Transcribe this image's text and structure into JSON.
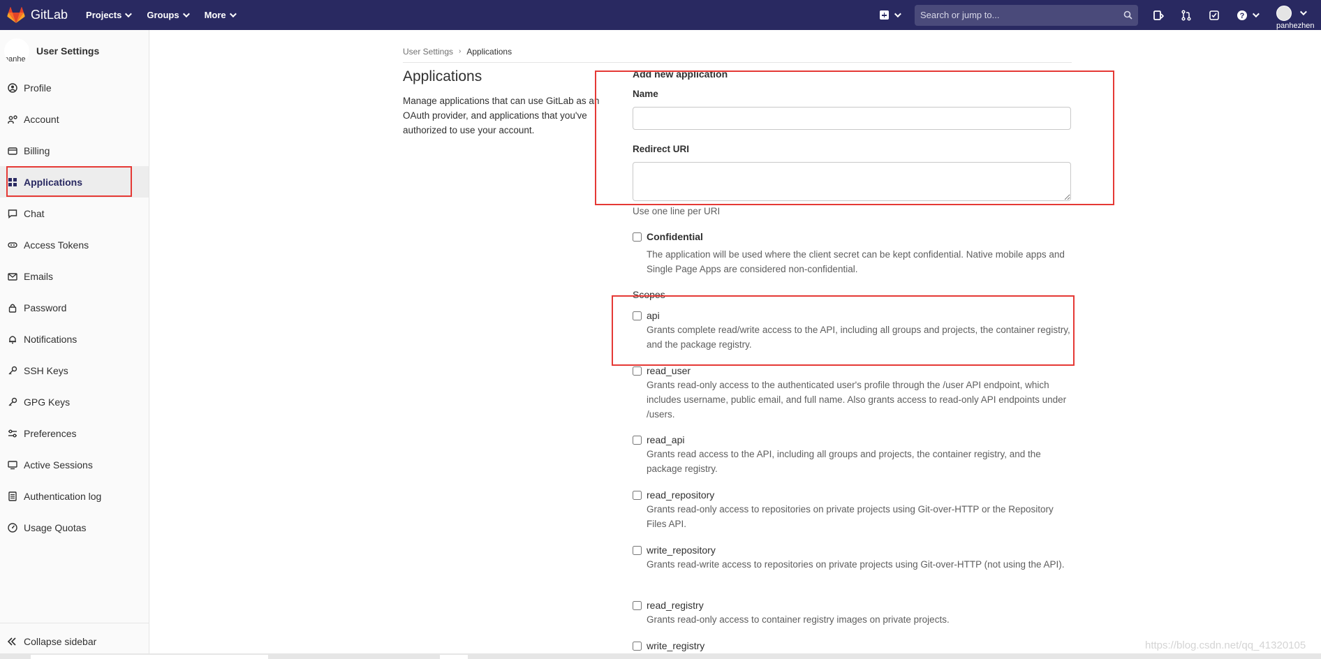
{
  "navbar": {
    "brand": "GitLab",
    "menu": [
      {
        "label": "Projects"
      },
      {
        "label": "Groups"
      },
      {
        "label": "More"
      }
    ],
    "search_placeholder": "Search or jump to...",
    "username": "panhezhen",
    "colors": {
      "bar": "#292961",
      "logo": "#e24329"
    }
  },
  "sidebar": {
    "title": "User Settings",
    "avatar_text": "panhe",
    "items": [
      {
        "label": "Profile",
        "icon": "profile-icon"
      },
      {
        "label": "Account",
        "icon": "account-icon"
      },
      {
        "label": "Billing",
        "icon": "billing-icon"
      },
      {
        "label": "Applications",
        "icon": "applications-icon",
        "active": true
      },
      {
        "label": "Chat",
        "icon": "chat-icon"
      },
      {
        "label": "Access Tokens",
        "icon": "token-icon"
      },
      {
        "label": "Emails",
        "icon": "email-icon"
      },
      {
        "label": "Password",
        "icon": "lock-icon"
      },
      {
        "label": "Notifications",
        "icon": "bell-icon"
      },
      {
        "label": "SSH Keys",
        "icon": "key-icon"
      },
      {
        "label": "GPG Keys",
        "icon": "key-icon"
      },
      {
        "label": "Preferences",
        "icon": "preferences-icon"
      },
      {
        "label": "Active Sessions",
        "icon": "monitor-icon"
      },
      {
        "label": "Authentication log",
        "icon": "log-icon"
      },
      {
        "label": "Usage Quotas",
        "icon": "quota-icon"
      }
    ],
    "collapse_label": "Collapse sidebar"
  },
  "breadcrumb": {
    "parent": "User Settings",
    "current": "Applications"
  },
  "main": {
    "title": "Applications",
    "description": "Manage applications that can use GitLab as an OAuth provider, and applications that you've authorized to use your account."
  },
  "form": {
    "section_title": "Add new application",
    "name_label": "Name",
    "name_value": "",
    "redirect_label": "Redirect URI",
    "redirect_value": "",
    "redirect_help": "Use one line per URI",
    "confidential_label": "Confidential",
    "confidential_checked": false,
    "confidential_desc": "The application will be used where the client secret can be kept confidential. Native mobile apps and Single Page Apps are considered non-confidential.",
    "scopes_title": "Scopes",
    "scopes": [
      {
        "name": "api",
        "checked": false,
        "desc": "Grants complete read/write access to the API, including all groups and projects, the container registry, and the package registry."
      },
      {
        "name": "read_user",
        "checked": false,
        "desc": "Grants read-only access to the authenticated user's profile through the /user API endpoint, which includes username, public email, and full name. Also grants access to read-only API endpoints under /users."
      },
      {
        "name": "read_api",
        "checked": false,
        "desc": "Grants read access to the API, including all groups and projects, the container registry, and the package registry."
      },
      {
        "name": "read_repository",
        "checked": false,
        "desc": "Grants read-only access to repositories on private projects using Git-over-HTTP or the Repository Files API."
      },
      {
        "name": "write_repository",
        "checked": false,
        "desc": "Grants read-write access to repositories on private projects using Git-over-HTTP (not using the API)."
      },
      {
        "name": "read_registry",
        "checked": false,
        "desc": "Grants read-only access to container registry images on private projects."
      },
      {
        "name": "write_registry",
        "checked": false,
        "desc": ""
      }
    ]
  },
  "annotation_color": "#e53935",
  "watermark": "https://blog.csdn.net/qq_41320105"
}
